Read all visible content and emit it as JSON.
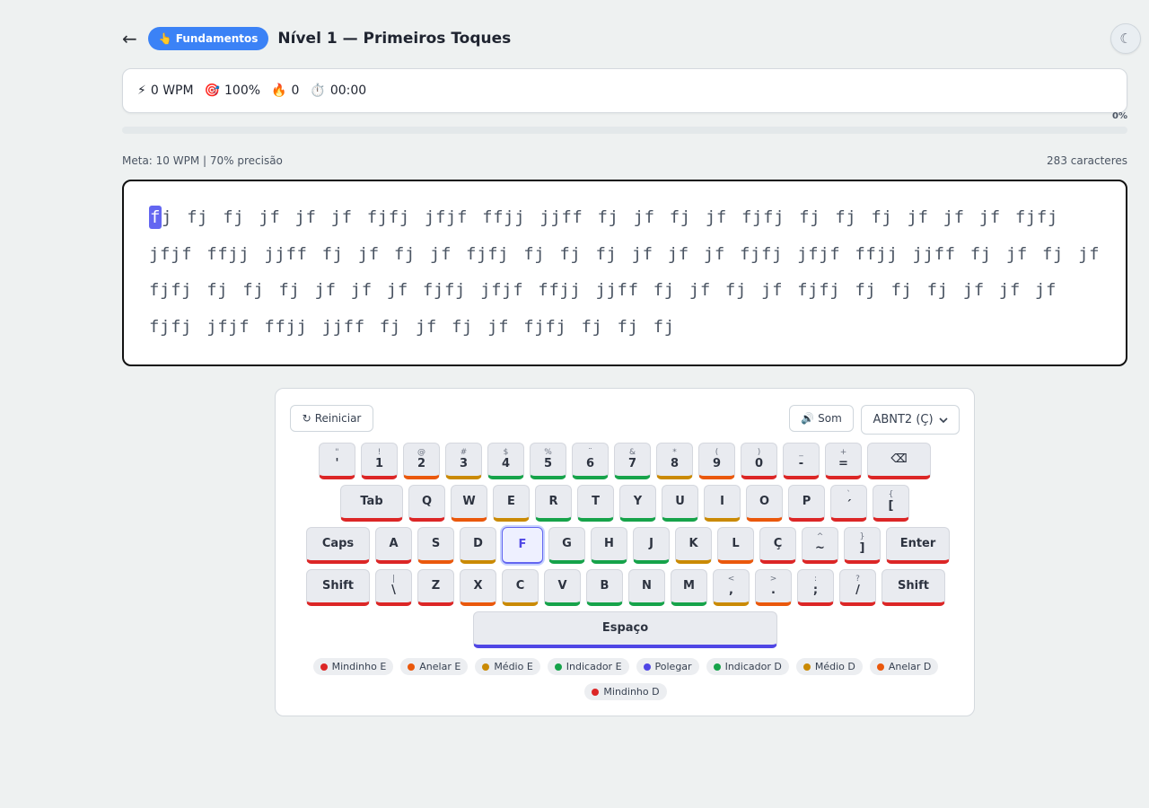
{
  "header": {
    "back_icon": "←",
    "badge_icon": "👆",
    "badge_label": "Fundamentos",
    "title": "Nível 1 — Primeiros Toques",
    "theme_icon": "☾"
  },
  "stats": {
    "wpm_icon": "⚡",
    "wpm": "0 WPM",
    "acc_icon": "🎯",
    "accuracy": "100%",
    "streak_icon": "🔥",
    "streak": "0",
    "time_icon": "⏱️",
    "time": "00:00"
  },
  "progress": {
    "label": "0%",
    "value": 0
  },
  "goal": "Meta: 10 WPM | 70% precisão",
  "char_count": "283 caracteres",
  "text": {
    "current_char": "f",
    "remaining": "j fj fj jf jf jf fjfj jfjf ffjj jjff fj jf fj jf fjfj fj fj fj jf jf jf fjfj jfjf ffjj jjff fj jf fj jf fjfj fj fj fj jf jf jf fjfj jfjf ffjj jjff fj jf fj jf fjfj fj fj fj jf jf jf fjfj jfjf ffjj jjff fj jf fj jf fjfj fj fj fj jf jf jf fjfj jfjf ffjj jjff fj jf fj jf fjfj fj fj fj"
  },
  "controls": {
    "restart_icon": "↻",
    "restart_label": "Reiniciar",
    "sound_icon": "🔊",
    "sound_label": "Som",
    "layout_value": "ABNT2 (Ç)"
  },
  "colors": {
    "pinky": "#dc2626",
    "ring": "#ea580c",
    "middle": "#ca8a04",
    "index": "#16a34a",
    "thumb": "#4f46e5",
    "accent": "#3b82f6"
  },
  "keyboard": {
    "rows": [
      [
        {
          "base": "'",
          "shift": "\"",
          "finger": "pinky"
        },
        {
          "base": "1",
          "shift": "!",
          "finger": "pinky"
        },
        {
          "base": "2",
          "shift": "@",
          "finger": "ring"
        },
        {
          "base": "3",
          "shift": "#",
          "finger": "middle"
        },
        {
          "base": "4",
          "shift": "$",
          "finger": "index"
        },
        {
          "base": "5",
          "shift": "%",
          "finger": "index"
        },
        {
          "base": "6",
          "shift": "¨",
          "finger": "index"
        },
        {
          "base": "7",
          "shift": "&",
          "finger": "index"
        },
        {
          "base": "8",
          "shift": "*",
          "finger": "middle"
        },
        {
          "base": "9",
          "shift": "(",
          "finger": "ring"
        },
        {
          "base": "0",
          "shift": ")",
          "finger": "pinky"
        },
        {
          "base": "-",
          "shift": "_",
          "finger": "pinky"
        },
        {
          "base": "=",
          "shift": "+",
          "finger": "pinky"
        },
        {
          "base": "⌫",
          "shift": "",
          "finger": "pinky"
        }
      ],
      [
        {
          "base": "Tab",
          "shift": "",
          "finger": "pinky"
        },
        {
          "base": "Q",
          "shift": "",
          "finger": "pinky"
        },
        {
          "base": "W",
          "shift": "",
          "finger": "ring"
        },
        {
          "base": "E",
          "shift": "",
          "finger": "middle"
        },
        {
          "base": "R",
          "shift": "",
          "finger": "index"
        },
        {
          "base": "T",
          "shift": "",
          "finger": "index"
        },
        {
          "base": "Y",
          "shift": "",
          "finger": "index"
        },
        {
          "base": "U",
          "shift": "",
          "finger": "index"
        },
        {
          "base": "I",
          "shift": "",
          "finger": "middle"
        },
        {
          "base": "O",
          "shift": "",
          "finger": "ring"
        },
        {
          "base": "P",
          "shift": "",
          "finger": "pinky"
        },
        {
          "base": "´",
          "shift": "`",
          "finger": "pinky"
        },
        {
          "base": "[",
          "shift": "{",
          "finger": "pinky"
        }
      ],
      [
        {
          "base": "Caps",
          "shift": "",
          "finger": "pinky"
        },
        {
          "base": "A",
          "shift": "",
          "finger": "pinky"
        },
        {
          "base": "S",
          "shift": "",
          "finger": "ring"
        },
        {
          "base": "D",
          "shift": "",
          "finger": "middle"
        },
        {
          "base": "F",
          "shift": "",
          "finger": "index",
          "active": true
        },
        {
          "base": "G",
          "shift": "",
          "finger": "index"
        },
        {
          "base": "H",
          "shift": "",
          "finger": "index"
        },
        {
          "base": "J",
          "shift": "",
          "finger": "index"
        },
        {
          "base": "K",
          "shift": "",
          "finger": "middle"
        },
        {
          "base": "L",
          "shift": "",
          "finger": "ring"
        },
        {
          "base": "Ç",
          "shift": "",
          "finger": "pinky"
        },
        {
          "base": "~",
          "shift": "^",
          "finger": "pinky"
        },
        {
          "base": "]",
          "shift": "}",
          "finger": "pinky"
        },
        {
          "base": "Enter",
          "shift": "",
          "finger": "pinky"
        }
      ],
      [
        {
          "base": "Shift",
          "shift": "",
          "finger": "pinky"
        },
        {
          "base": "\\",
          "shift": "|",
          "finger": "pinky"
        },
        {
          "base": "Z",
          "shift": "",
          "finger": "pinky"
        },
        {
          "base": "X",
          "shift": "",
          "finger": "ring"
        },
        {
          "base": "C",
          "shift": "",
          "finger": "middle"
        },
        {
          "base": "V",
          "shift": "",
          "finger": "index"
        },
        {
          "base": "B",
          "shift": "",
          "finger": "index"
        },
        {
          "base": "N",
          "shift": "",
          "finger": "index"
        },
        {
          "base": "M",
          "shift": "",
          "finger": "index"
        },
        {
          "base": ",",
          "shift": "<",
          "finger": "middle"
        },
        {
          "base": ".",
          "shift": ">",
          "finger": "ring"
        },
        {
          "base": ";",
          "shift": ":",
          "finger": "pinky"
        },
        {
          "base": "/",
          "shift": "?",
          "finger": "pinky"
        },
        {
          "base": "Shift",
          "shift": "",
          "finger": "pinky"
        }
      ],
      [
        {
          "base": "Espaço",
          "shift": "",
          "finger": "thumb"
        }
      ]
    ]
  },
  "legend": [
    {
      "label": "Mindinho E",
      "finger": "pinky"
    },
    {
      "label": "Anelar E",
      "finger": "ring"
    },
    {
      "label": "Médio E",
      "finger": "middle"
    },
    {
      "label": "Indicador E",
      "finger": "index"
    },
    {
      "label": "Polegar",
      "finger": "thumb"
    },
    {
      "label": "Indicador D",
      "finger": "index"
    },
    {
      "label": "Médio D",
      "finger": "middle"
    },
    {
      "label": "Anelar D",
      "finger": "ring"
    },
    {
      "label": "Mindinho D",
      "finger": "pinky"
    }
  ]
}
